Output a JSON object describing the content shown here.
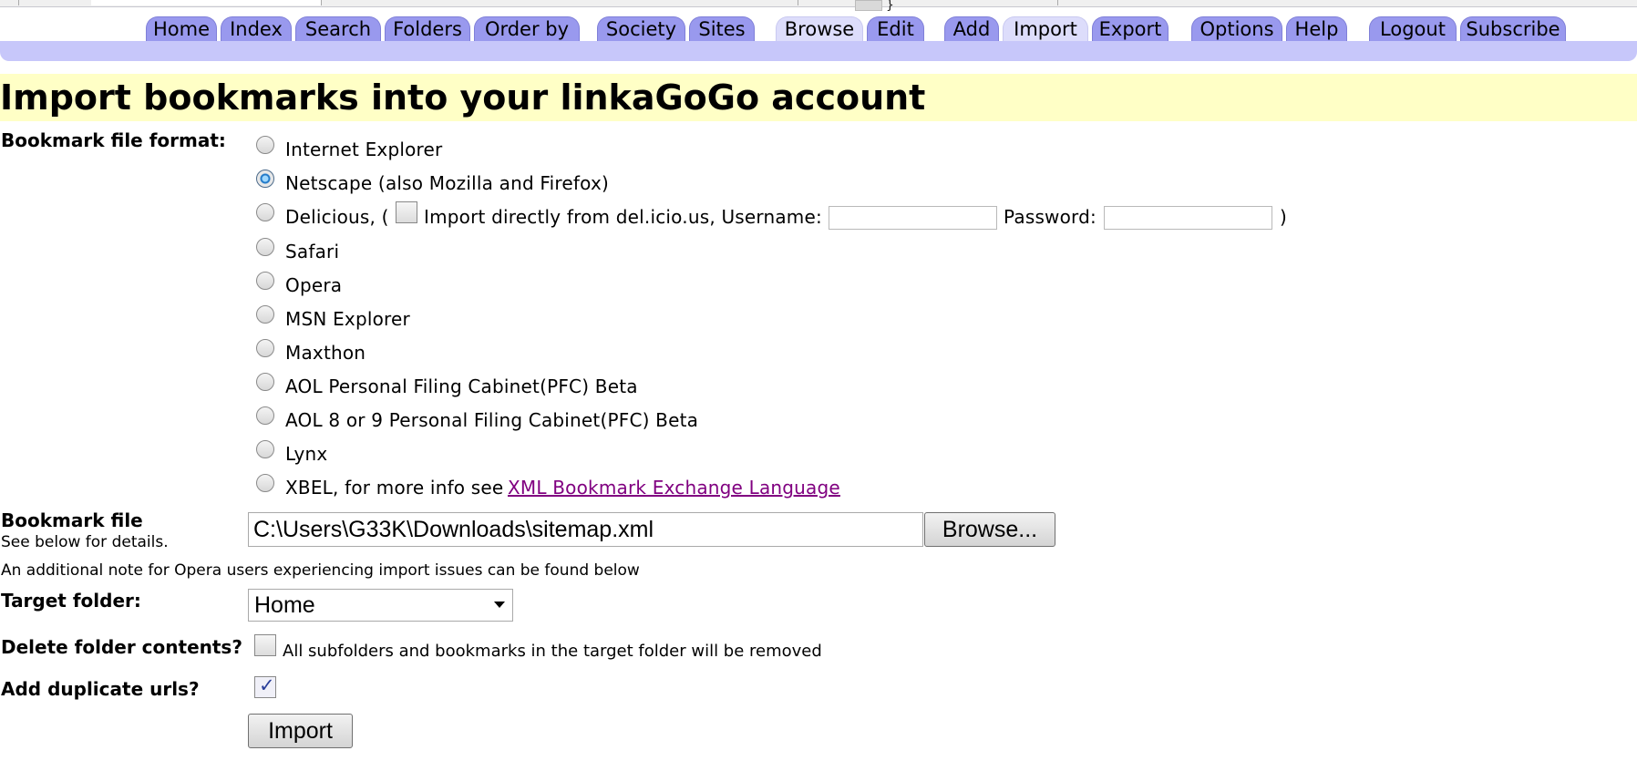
{
  "nav": {
    "tabs": [
      {
        "label": "Home"
      },
      {
        "label": "Index"
      },
      {
        "label": "Search"
      },
      {
        "label": "Folders"
      },
      {
        "label": "Order by"
      },
      {
        "label": "Society"
      },
      {
        "label": "Sites"
      },
      {
        "label": "Browse",
        "active": true
      },
      {
        "label": "Edit"
      },
      {
        "label": "Add"
      },
      {
        "label": "Import",
        "active": true
      },
      {
        "label": "Export"
      },
      {
        "label": "Options"
      },
      {
        "label": "Help"
      },
      {
        "label": "Logout"
      },
      {
        "label": "Subscribe"
      }
    ],
    "tab_color": "#9999ee",
    "active_tab_color": "#ddddfb",
    "bar_color": "#c7c7fa"
  },
  "page": {
    "title": "Import bookmarks into your linkaGoGo account",
    "title_bg": "#ffffc6"
  },
  "format": {
    "label": "Bookmark file format:",
    "options": [
      {
        "label": "Internet Explorer",
        "checked": false
      },
      {
        "label": "Netscape (also Mozilla and Firefox)",
        "checked": true
      },
      {
        "label": "Delicious, (",
        "checked": false
      },
      {
        "label": "Safari",
        "checked": false
      },
      {
        "label": "Opera",
        "checked": false
      },
      {
        "label": "MSN Explorer",
        "checked": false
      },
      {
        "label": "Maxthon",
        "checked": false
      },
      {
        "label": "AOL Personal Filing Cabinet(PFC) Beta",
        "checked": false
      },
      {
        "label": "AOL 8 or 9 Personal Filing Cabinet(PFC) Beta",
        "checked": false
      },
      {
        "label": "Lynx",
        "checked": false
      },
      {
        "label": "XBEL, for more info see",
        "checked": false
      }
    ],
    "delicious": {
      "direct_label": "Import directly from del.icio.us, Username:",
      "direct_checked": false,
      "password_label": "Password:",
      "close_paren": ")",
      "username_value": "",
      "password_value": ""
    },
    "xbel_link": "XML Bookmark Exchange Language"
  },
  "file": {
    "label": "Bookmark file",
    "sublabel": "See below for details.",
    "value": "C:\\Users\\G33K\\Downloads\\sitemap.xml",
    "browse_label": "Browse...",
    "opera_note": "An additional note for Opera users experiencing import issues can be found below"
  },
  "target": {
    "label": "Target folder:",
    "selected": "Home"
  },
  "delete": {
    "label": "Delete folder contents?",
    "checked": false,
    "note": "All subfolders and bookmarks in the target folder will be removed"
  },
  "duplicates": {
    "label": "Add duplicate urls?",
    "checked": true
  },
  "import_button": "Import",
  "link_color": "#800080"
}
